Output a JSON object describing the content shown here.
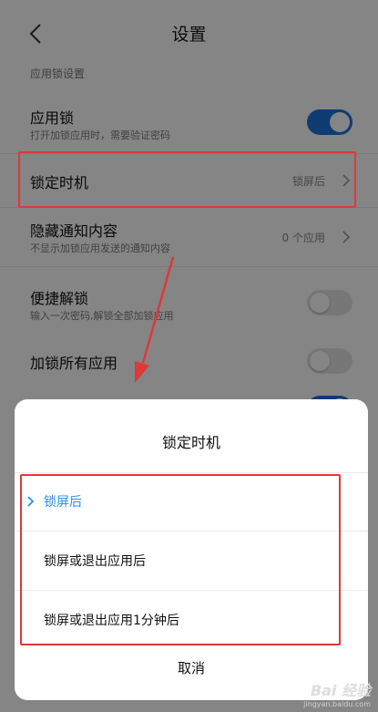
{
  "header": {
    "title": "设置"
  },
  "section": {
    "title": "应用锁设置"
  },
  "rows": {
    "app_lock": {
      "label": "应用锁",
      "sub": "打开加锁应用时，需要验证密码",
      "toggle": "on"
    },
    "lock_timing": {
      "label": "锁定时机",
      "value": "锁屏后"
    },
    "hide_notif": {
      "label": "隐藏通知内容",
      "sub": "不显示加锁应用发送的通知内容",
      "value": "0 个应用"
    },
    "quick_unlock": {
      "label": "便捷解锁",
      "sub": "输入一次密码,解锁全部加锁应用",
      "toggle": "off"
    },
    "lock_all": {
      "label": "加锁所有应用",
      "toggle": "off"
    }
  },
  "sheet": {
    "title": "锁定时机",
    "options": [
      {
        "label": "锁屏后",
        "selected": true
      },
      {
        "label": "锁屏或退出应用后",
        "selected": false
      },
      {
        "label": "锁屏或退出应用1分钟后",
        "selected": false
      }
    ],
    "cancel": "取消"
  },
  "watermark": {
    "main": "Bai 经验",
    "sub": "jingyan.baidu.com"
  },
  "colors": {
    "accent": "#1e74d9",
    "selected_text": "#2b8fe7",
    "annotation": "#e0373a"
  }
}
